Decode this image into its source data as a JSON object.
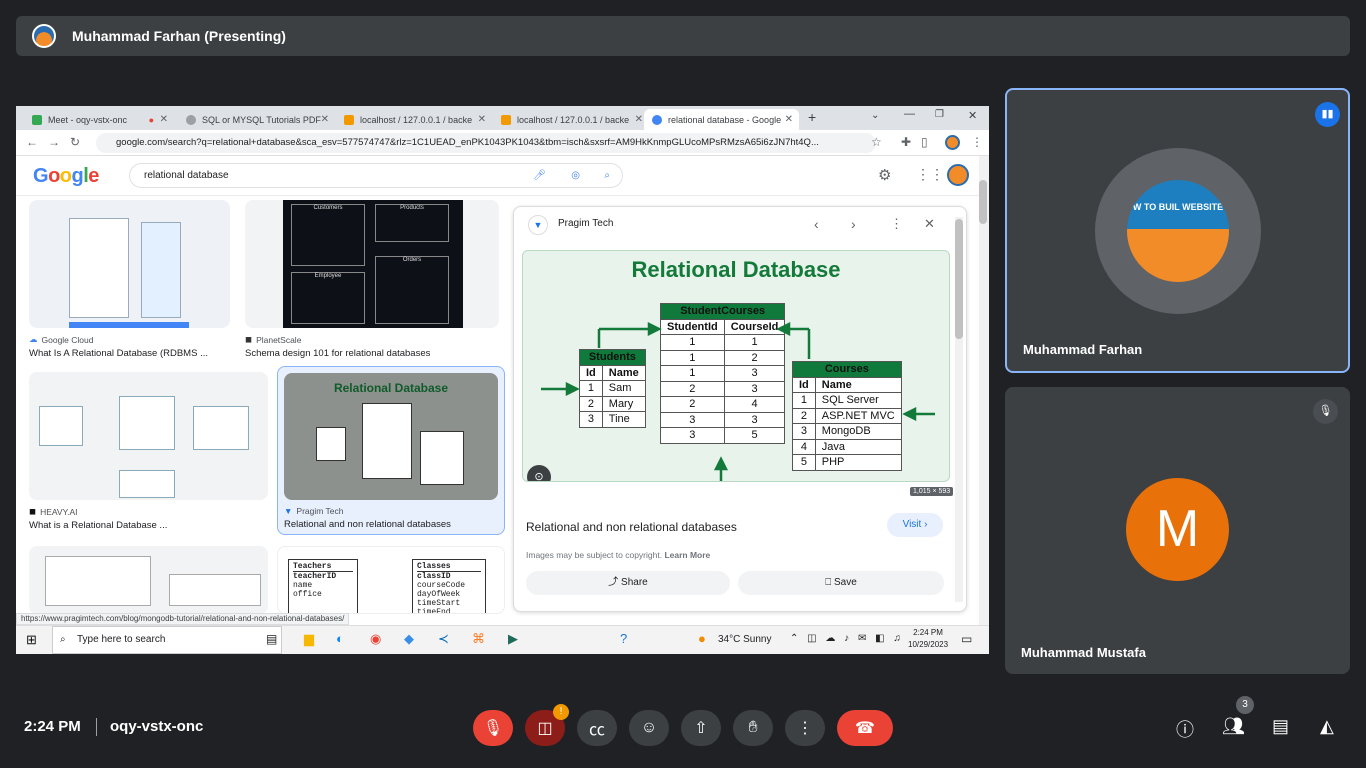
{
  "presenter": {
    "name": "Muhammad Farhan (Presenting)"
  },
  "browser": {
    "tabs": [
      {
        "label": "Meet - oqy-vstx-onc",
        "color": "#34a853"
      },
      {
        "label": "SQL or MYSQL Tutorials PDF",
        "color": "#5f6368"
      },
      {
        "label": "localhost / 127.0.0.1 / backe",
        "color": "#f29900"
      },
      {
        "label": "localhost / 127.0.0.1 / backe",
        "color": "#f29900"
      },
      {
        "label": "relational database - Google",
        "color": "#4285f4"
      }
    ],
    "url": "google.com/search?q=relational+database&sca_esv=577574747&rlz=1C1UEAD_enPK1043PK1043&tbm=isch&sxsrf=AM9HkKnmpGLUcoMPsRMzsA65i6zJN7ht4Q...",
    "status_url": "https://www.pragimtech.com/blog/mongodb-tutorial/relational-and-non-relational-databases/"
  },
  "google": {
    "logo": "Google",
    "query": "relational database"
  },
  "results": [
    {
      "source": "Google Cloud",
      "title": "What Is A Relational Database (RDBMS ..."
    },
    {
      "source": "PlanetScale",
      "title": "Schema design 101 for relational databases"
    },
    {
      "source": "HEAVY.AI",
      "title": "What is a Relational Database ..."
    },
    {
      "source": "Pragim Tech",
      "title": "Relational and non relational databases",
      "thumb_title": "Relational Database"
    }
  ],
  "panel": {
    "source": "Pragim Tech",
    "image_title": "Relational Database",
    "size_badge": "1,015 × 593",
    "caption": "Relational and non relational databases",
    "visit": "Visit",
    "copyright": "Images may be subject to copyright.",
    "learn_more": "Learn More",
    "share": "Share",
    "save": "Save",
    "students": {
      "title": "Students",
      "headers": [
        "Id",
        "Name"
      ],
      "rows": [
        [
          "1",
          "Sam"
        ],
        [
          "2",
          "Mary"
        ],
        [
          "3",
          "Tine"
        ]
      ]
    },
    "student_courses": {
      "title": "StudentCourses",
      "headers": [
        "StudentId",
        "CourseId"
      ],
      "rows": [
        [
          "1",
          "1"
        ],
        [
          "1",
          "2"
        ],
        [
          "1",
          "3"
        ],
        [
          "2",
          "3"
        ],
        [
          "2",
          "4"
        ],
        [
          "3",
          "3"
        ],
        [
          "3",
          "5"
        ]
      ]
    },
    "courses": {
      "title": "Courses",
      "headers": [
        "Id",
        "Name"
      ],
      "rows": [
        [
          "1",
          "SQL Server"
        ],
        [
          "2",
          "ASP.NET MVC"
        ],
        [
          "3",
          "MongoDB"
        ],
        [
          "4",
          "Java"
        ],
        [
          "5",
          "PHP"
        ]
      ]
    }
  },
  "thumb_planetscale": {
    "customers": "Customers",
    "products": "Products",
    "employee": "Employee",
    "orders": "Orders"
  },
  "thumb_teachers": {
    "teachers": "Teachers",
    "classes": "Classes",
    "teacher_fields": [
      "teacherID",
      "name",
      "office"
    ],
    "class_fields": [
      "classID",
      "courseCode",
      "dayOfWeek",
      "timeStart",
      "timeEnd"
    ]
  },
  "taskbar": {
    "search_placeholder": "Type here to search",
    "weather": "34°C  Sunny",
    "time": "2:24 PM",
    "date": "10/29/2023"
  },
  "participants": [
    {
      "name": "Muhammad Farhan",
      "avatar_text": "W TO BUIL WEBSITE"
    },
    {
      "name": "Muhammad Mustafa",
      "initial": "M"
    }
  ],
  "meeting": {
    "time": "2:24 PM",
    "code": "oqy-vstx-onc",
    "participant_count": "3",
    "alert": "!"
  },
  "colors": {
    "accent": "#8ab4f8",
    "end_call": "#ea4335",
    "avatar_m": "#e8710a"
  }
}
